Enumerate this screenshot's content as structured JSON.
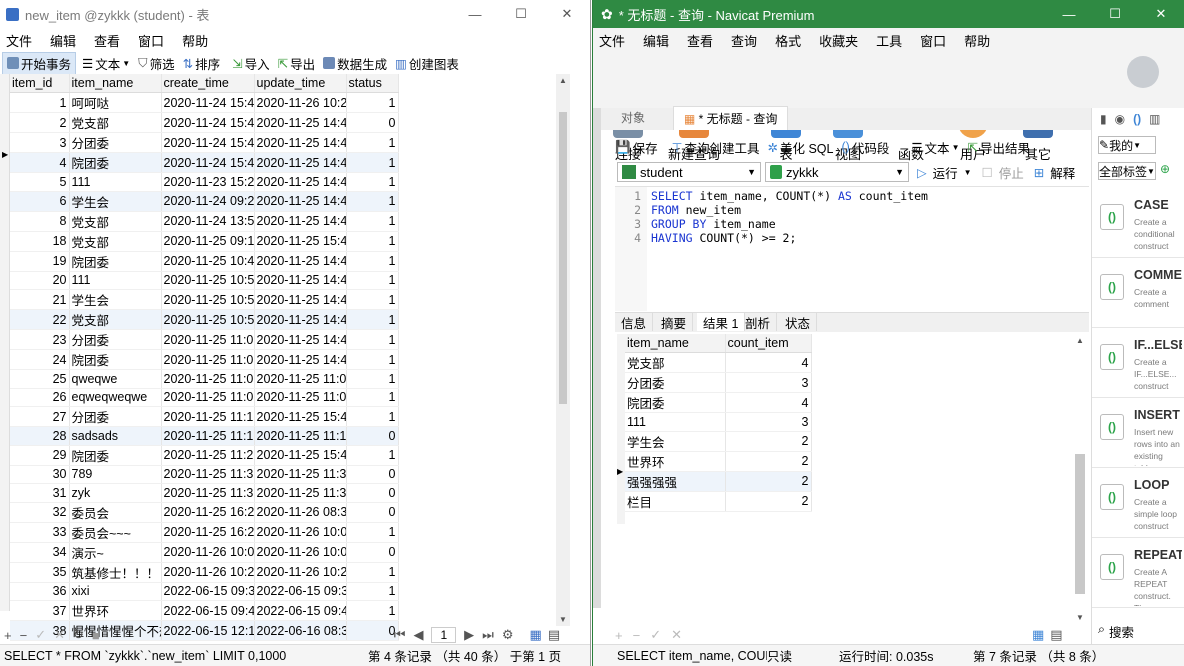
{
  "left": {
    "title": "new_item @zykkk (student) - 表",
    "menu": [
      "文件",
      "编辑",
      "查看",
      "窗口",
      "帮助"
    ],
    "toolbar": {
      "begin_tx": "开始事务",
      "text": "文本",
      "filter": "筛选",
      "sort": "排序",
      "import": "导入",
      "export": "导出",
      "datagen": "数据生成",
      "chart": "创建图表"
    },
    "columns": [
      "item_id",
      "item_name",
      "create_time",
      "update_time",
      "status"
    ],
    "rows": [
      [
        "1",
        "呵呵哒",
        "2020-11-24 15:4",
        "2020-11-26 10:2",
        "1"
      ],
      [
        "2",
        "党支部",
        "2020-11-24 15:4",
        "2020-11-25 14:4",
        "0"
      ],
      [
        "3",
        "分团委",
        "2020-11-24 15:4",
        "2020-11-25 14:4",
        "1"
      ],
      [
        "4",
        "院团委",
        "2020-11-24 15:4",
        "2020-11-25 14:4",
        "1"
      ],
      [
        "5",
        "111",
        "2020-11-23 15:2",
        "2020-11-25 14:4",
        "1"
      ],
      [
        "6",
        "学生会",
        "2020-11-24 09:2",
        "2020-11-25 14:4",
        "1"
      ],
      [
        "8",
        "党支部",
        "2020-11-24 13:5",
        "2020-11-25 14:4",
        "1"
      ],
      [
        "18",
        "党支部",
        "2020-11-25 09:1",
        "2020-11-25 15:4",
        "1"
      ],
      [
        "19",
        "院团委",
        "2020-11-25 10:4",
        "2020-11-25 14:4",
        "1"
      ],
      [
        "20",
        "111",
        "2020-11-25 10:5",
        "2020-11-25 14:4",
        "1"
      ],
      [
        "21",
        "学生会",
        "2020-11-25 10:5",
        "2020-11-25 14:4",
        "1"
      ],
      [
        "22",
        "党支部",
        "2020-11-25 10:5",
        "2020-11-25 14:4",
        "1"
      ],
      [
        "23",
        "分团委",
        "2020-11-25 11:0",
        "2020-11-25 14:4",
        "1"
      ],
      [
        "24",
        "院团委",
        "2020-11-25 11:0",
        "2020-11-25 14:4",
        "1"
      ],
      [
        "25",
        "qweqwe",
        "2020-11-25 11:0",
        "2020-11-25 11:0",
        "1"
      ],
      [
        "26",
        "eqweqweqwe",
        "2020-11-25 11:0",
        "2020-11-25 11:0",
        "1"
      ],
      [
        "27",
        "分团委",
        "2020-11-25 11:1",
        "2020-11-25 15:4",
        "1"
      ],
      [
        "28",
        "sadsads",
        "2020-11-25 11:1",
        "2020-11-25 11:1",
        "0"
      ],
      [
        "29",
        "院团委",
        "2020-11-25 11:2",
        "2020-11-25 15:4",
        "1"
      ],
      [
        "30",
        "789",
        "2020-11-25 11:3",
        "2020-11-25 11:3",
        "0"
      ],
      [
        "31",
        "zyk",
        "2020-11-25 11:3",
        "2020-11-25 11:3",
        "0"
      ],
      [
        "32",
        "委员会",
        "2020-11-25 16:2",
        "2020-11-26 08:3",
        "0"
      ],
      [
        "33",
        "委员会~~~",
        "2020-11-25 16:2",
        "2020-11-26 10:0",
        "1"
      ],
      [
        "34",
        "演示~",
        "2020-11-26 10:0",
        "2020-11-26 10:0",
        "0"
      ],
      [
        "35",
        "筑基修士！！！",
        "2020-11-26 10:2",
        "2020-11-26 10:2",
        "1"
      ],
      [
        "36",
        "xixi",
        "2022-06-15 09:3",
        "2022-06-15 09:3",
        "1"
      ],
      [
        "37",
        "世界环",
        "2022-06-15 09:4",
        "2022-06-15 09:4",
        "1"
      ],
      [
        "38",
        "惺惺惜惺惺个不想想",
        "2022-06-15 12:1",
        "2022-06-16 08:3",
        "0"
      ]
    ],
    "page_number": "1",
    "status_sql": "SELECT * FROM `zykkk`.`new_item` LIMIT 0,1000",
    "status_record": "第 4 条记录 （共 40 条） 于第 1 页"
  },
  "right": {
    "title": "* 无标题 - 查询 - Navicat Premium",
    "menu": [
      "文件",
      "编辑",
      "查看",
      "查询",
      "格式",
      "收藏夹",
      "工具",
      "窗口",
      "帮助"
    ],
    "ribbon": [
      "连接",
      "新建查询",
      "表",
      "视图",
      "函数",
      "用户",
      "其它"
    ],
    "tabs": {
      "objects": "对象",
      "query": "* 无标题 - 查询"
    },
    "qtoolbar": {
      "save": "保存",
      "builder": "查询创建工具",
      "beautify": "美化 SQL",
      "snippet": "代码段",
      "text": "文本",
      "export": "导出结果"
    },
    "connection": "student",
    "database": "zykkk",
    "run": "运行",
    "stop": "停止",
    "explain": "解释",
    "sql_lines": [
      {
        "n": "1",
        "a": "SELECT",
        "b": " item_name, COUNT(*) ",
        "c": "AS",
        "d": " count_item"
      },
      {
        "n": "2",
        "a": "FROM",
        "b": " new_item",
        "c": "",
        "d": ""
      },
      {
        "n": "3",
        "a": "GROUP BY",
        "b": " item_name",
        "c": "",
        "d": ""
      },
      {
        "n": "4",
        "a": "HAVING",
        "b": " COUNT(*) >= 2;",
        "c": "",
        "d": ""
      }
    ],
    "result_tabs": [
      "信息",
      "摘要",
      "结果 1",
      "剖析",
      "状态"
    ],
    "result_columns": [
      "item_name",
      "count_item"
    ],
    "result_rows": [
      [
        "党支部",
        "4"
      ],
      [
        "分团委",
        "3"
      ],
      [
        "院团委",
        "4"
      ],
      [
        "111",
        "3"
      ],
      [
        "学生会",
        "2"
      ],
      [
        "世界环",
        "2"
      ],
      [
        "强强强强",
        "2"
      ],
      [
        "栏目",
        "2"
      ]
    ],
    "status_sql": "SELECT item_name, COUNT",
    "status_readonly": "只读",
    "status_time": "运行时间: 0.035s",
    "status_record": "第 7 条记录 （共 8 条）",
    "side": {
      "db_label": "我的",
      "tag_label": "全部标签",
      "search": "搜索",
      "snippets": [
        {
          "title": "CASE",
          "desc": "Create a conditional construct"
        },
        {
          "title": "COMMENT",
          "desc": "Create a comment"
        },
        {
          "title": "IF...ELSE",
          "desc": "Create a IF...ELSE... construct"
        },
        {
          "title": "INSERT",
          "desc": "Insert new rows into an existing table"
        },
        {
          "title": "LOOP",
          "desc": "Create a simple loop construct"
        },
        {
          "title": "REPEAT",
          "desc": "Create A REPEAT construct. The"
        }
      ]
    }
  }
}
